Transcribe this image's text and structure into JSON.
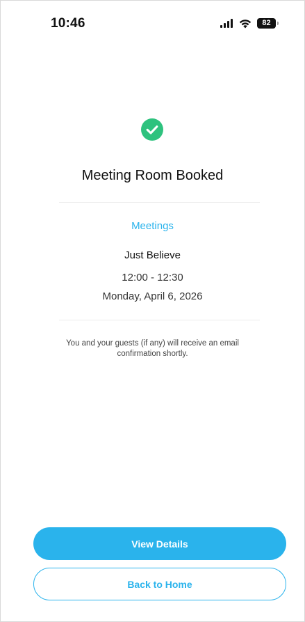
{
  "status_bar": {
    "time": "10:46",
    "battery_level": "82",
    "icons": [
      "signal-icon",
      "wifi-icon",
      "battery-icon"
    ]
  },
  "confirmation": {
    "icon": "check-circle-icon",
    "title": "Meeting Room Booked",
    "category": "Meetings",
    "room_name": "Just Believe",
    "time_range": "12:00 - 12:30",
    "date": "Monday, April 6, 2026",
    "note": "You and your guests (if any) will receive an email confirmation shortly."
  },
  "actions": {
    "view_details_label": "View Details",
    "back_home_label": "Back to Home"
  },
  "colors": {
    "accent": "#2ab3ec",
    "success": "#2ec27e"
  }
}
